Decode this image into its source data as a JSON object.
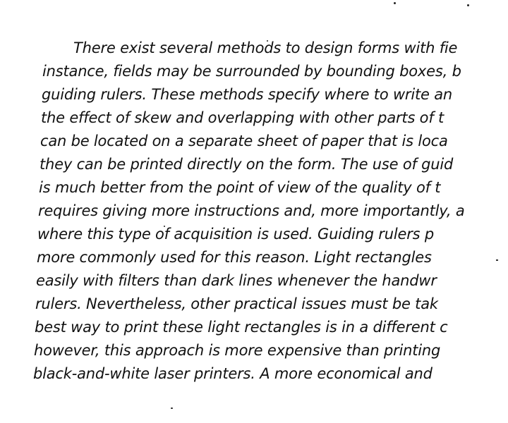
{
  "document": {
    "lines": [
      "There exist several methods to design forms with fie",
      "instance, fields may be surrounded by bounding boxes, b",
      "guiding rulers.  These methods specify where to write an",
      "the effect of skew and overlapping with other parts of t",
      "can be located on a separate sheet of paper that is loca",
      "they can be printed directly on the form.  The use of guid",
      "is much better from the point of view of the quality of t",
      "requires giving more instructions and, more importantly, a",
      "where this type of acquisition is used.  Guiding rulers p",
      "more commonly used for this reason.  Light rectangles",
      "easily with filters than dark lines whenever the handwr",
      "rulers.  Nevertheless, other practical issues must be tak",
      "best way to print these light rectangles is in a different c",
      "however, this approach is more expensive than printing",
      "black-and-white laser printers.  A more economical and"
    ]
  }
}
